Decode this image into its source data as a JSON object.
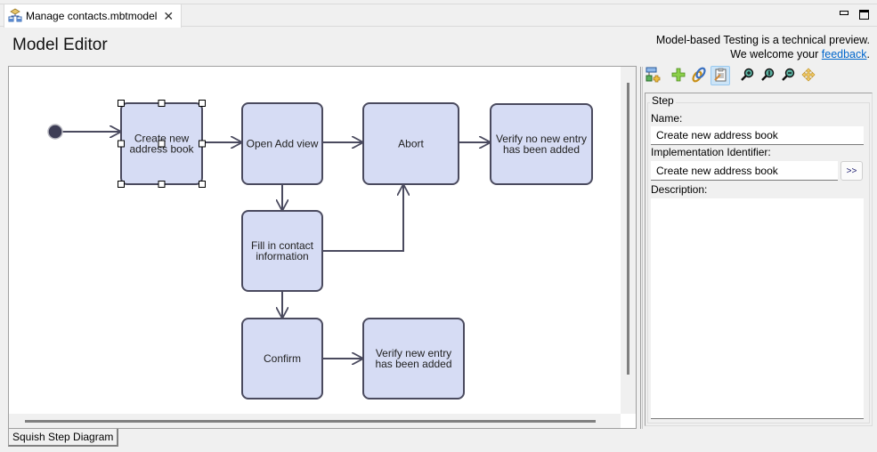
{
  "editor_tab": {
    "label": "Manage contacts.mbtmodel",
    "icon": "model-file-icon",
    "close_glyph": "✕"
  },
  "window_controls": {
    "minimize": "minimize-icon",
    "maximize": "maximize-icon"
  },
  "editor": {
    "title": "Model Editor",
    "preview_line1": "Model-based Testing is a technical preview.",
    "preview_line2_prefix": "We welcome your ",
    "feedback_link": "feedback",
    "preview_line2_suffix": "."
  },
  "diagram": {
    "start_node": "start",
    "selected_node": "Create new address book",
    "nodes": [
      {
        "id": "n1",
        "label_lines": [
          "Create new",
          "address book"
        ]
      },
      {
        "id": "n2",
        "label_lines": [
          "Open Add view"
        ]
      },
      {
        "id": "n3",
        "label_lines": [
          "Abort"
        ]
      },
      {
        "id": "n4",
        "label_lines": [
          "Verify no new entry",
          "has been added"
        ]
      },
      {
        "id": "n5",
        "label_lines": [
          "Fill in contact",
          "information"
        ]
      },
      {
        "id": "n6",
        "label_lines": [
          "Confirm"
        ]
      },
      {
        "id": "n7",
        "label_lines": [
          "Verify new entry",
          "has been added"
        ]
      }
    ],
    "edges": [
      [
        "start",
        "n1"
      ],
      [
        "n1",
        "n2"
      ],
      [
        "n2",
        "n3"
      ],
      [
        "n3",
        "n4"
      ],
      [
        "n2",
        "n5"
      ],
      [
        "n5",
        "n3"
      ],
      [
        "n5",
        "n6"
      ],
      [
        "n6",
        "n7"
      ]
    ],
    "colors": {
      "node_fill": "#d6dcf4",
      "node_stroke": "#4a4a5e",
      "edge": "#4a4a5e",
      "start_fill": "#3d3d55"
    }
  },
  "bottom_tab": {
    "label": "Squish Step Diagram"
  },
  "toolbar": {
    "buttons": [
      {
        "name": "add-step-icon",
        "tooltip": ""
      },
      {
        "name": "add-icon",
        "tooltip": ""
      },
      {
        "name": "link-icon",
        "tooltip": ""
      },
      {
        "name": "properties-icon",
        "tooltip": "",
        "active": true
      },
      {
        "name": "zoom-in-icon",
        "tooltip": ""
      },
      {
        "name": "zoom-reset-icon",
        "tooltip": ""
      },
      {
        "name": "zoom-out-icon",
        "tooltip": ""
      },
      {
        "name": "move-icon",
        "tooltip": ""
      }
    ]
  },
  "step_panel": {
    "group_title": "Step",
    "name_label": "Name:",
    "name_value": "Create new address book",
    "impl_label": "Implementation Identifier:",
    "impl_value": "Create new address book",
    "browse_label": ">>",
    "description_label": "Description:",
    "description_value": ""
  }
}
